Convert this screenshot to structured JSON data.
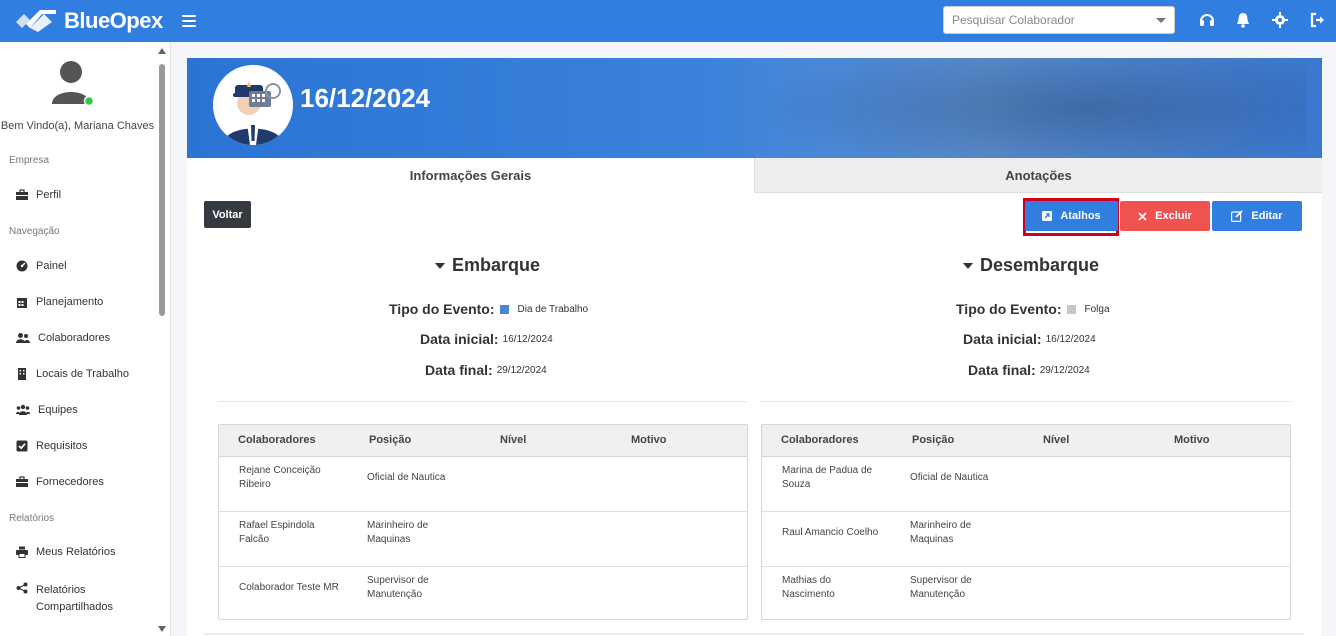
{
  "app": {
    "name": "BlueOpex",
    "search_placeholder": "Pesquisar Colaborador"
  },
  "sidebar": {
    "welcome": "Bem Vindo(a), Mariana Chaves",
    "sections": {
      "empresa": "Empresa",
      "navegacao": "Navegação",
      "relatorios": "Relatórios"
    },
    "items": [
      {
        "label": "Perfil",
        "icon": "briefcase-icon"
      },
      {
        "label": "Painel",
        "icon": "dashboard-icon"
      },
      {
        "label": "Planejamento",
        "icon": "calendar-icon"
      },
      {
        "label": "Colaboradores",
        "icon": "users-icon"
      },
      {
        "label": "Locais de Trabalho",
        "icon": "building-icon"
      },
      {
        "label": "Equipes",
        "icon": "team-icon"
      },
      {
        "label": "Requisitos",
        "icon": "checkbox-icon"
      },
      {
        "label": "Fornecedores",
        "icon": "briefcase-icon"
      },
      {
        "label": "Meus Relatórios",
        "icon": "printer-icon"
      },
      {
        "label": "Relatórios Compartilhados",
        "icon": "share-icon"
      }
    ]
  },
  "header": {
    "date": "16/12/2024"
  },
  "tabs": {
    "general": "Informações Gerais",
    "notes": "Anotações"
  },
  "actions": {
    "back": "Voltar",
    "shortcuts": "Atalhos",
    "delete": "Excluir",
    "edit": "Editar"
  },
  "embarque": {
    "title": "Embarque",
    "event_label": "Tipo do Evento:",
    "event_value": "Dia de Trabalho",
    "event_color": "#4a86d8",
    "start_label": "Data inicial:",
    "start_value": "16/12/2024",
    "end_label": "Data final:",
    "end_value": "29/12/2024",
    "columns": [
      "Colaboradores",
      "Posição",
      "Nível",
      "Motivo"
    ],
    "rows": [
      {
        "name": "Rejane Conceição Ribeiro",
        "position": "Oficial de Nautica"
      },
      {
        "name": "Rafael Espindola Falcão",
        "position": "Marinheiro de Maquinas"
      },
      {
        "name": "Colaborador Teste MR",
        "position": "Supervisor de Manutenção"
      }
    ]
  },
  "desembarque": {
    "title": "Desembarque",
    "event_label": "Tipo do Evento:",
    "event_value": "Folga",
    "event_color": "#c8c8c8",
    "start_label": "Data inicial:",
    "start_value": "16/12/2024",
    "end_label": "Data final:",
    "end_value": "29/12/2024",
    "columns": [
      "Colaboradores",
      "Posição",
      "Nível",
      "Motivo"
    ],
    "rows": [
      {
        "name": "Marina de Padua de Souza",
        "position": "Oficial de Nautica"
      },
      {
        "name": "Raul Amancio Coelho",
        "position": "Marinheiro de Maquinas"
      },
      {
        "name": "Mathias do Nascimento",
        "position": "Supervisor de Manutenção"
      }
    ]
  },
  "colors": {
    "primary": "#2f7ee0",
    "danger": "#ef5350",
    "dark": "#343a40",
    "highlight": "#d0021b"
  }
}
